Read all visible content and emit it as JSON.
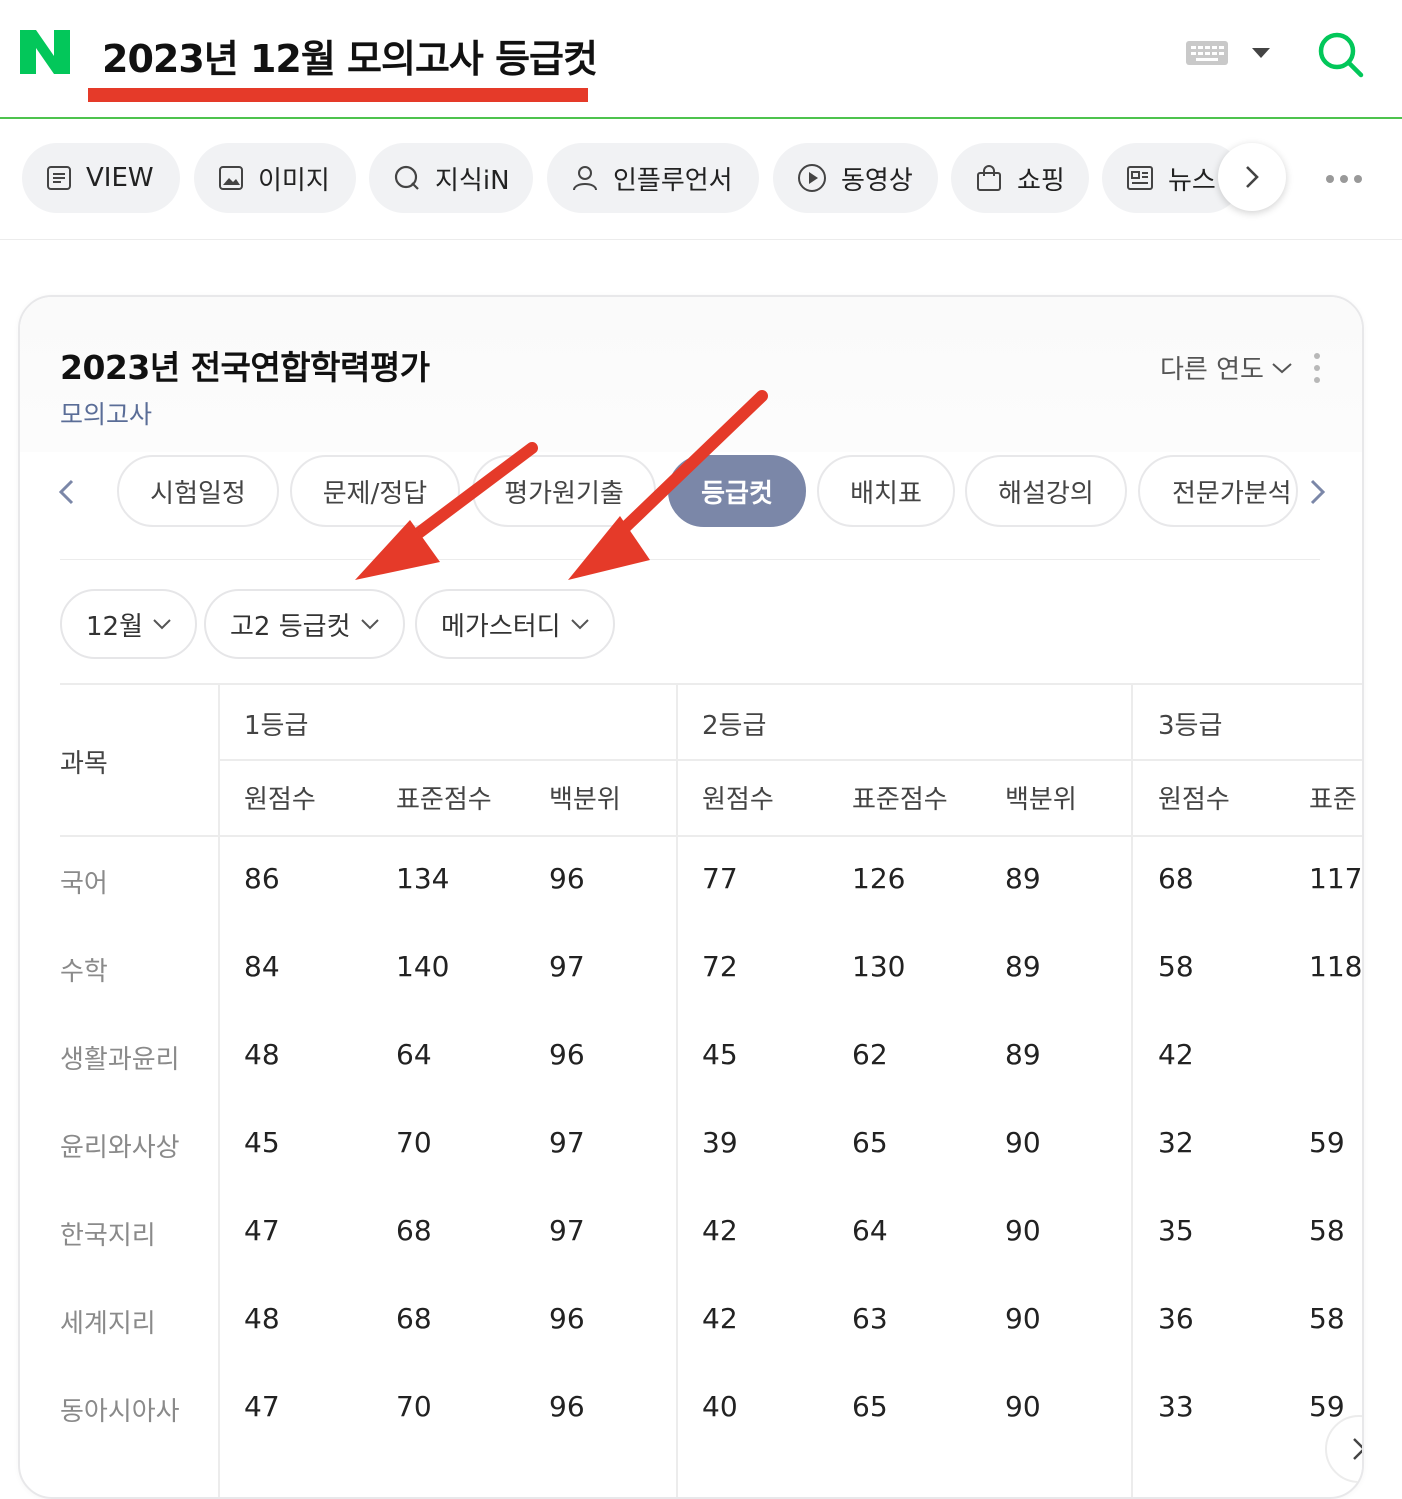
{
  "header": {
    "logo_letter": "N",
    "query": "2023년 12월 모의고사 등급컷",
    "brand_color": "#03c75a",
    "annotation_color": "#e53a29"
  },
  "tabs": [
    {
      "label": "VIEW",
      "icon": "document-list-icon"
    },
    {
      "label": "이미지",
      "icon": "image-icon"
    },
    {
      "label": "지식iN",
      "icon": "q-search-icon"
    },
    {
      "label": "인플루언서",
      "icon": "person-icon"
    },
    {
      "label": "동영상",
      "icon": "play-icon"
    },
    {
      "label": "쇼핑",
      "icon": "shopping-bag-icon"
    },
    {
      "label": "뉴스",
      "icon": "newspaper-icon"
    }
  ],
  "card": {
    "title": "2023년 전국연합학력평가",
    "subtitle": "모의고사",
    "year_select": "다른 연도",
    "sub_tabs": [
      "시험일정",
      "문제/정답",
      "평가원기출",
      "등급컷",
      "배치표",
      "해설강의",
      "전문가분석"
    ],
    "active_sub_tab": "등급컷",
    "active_color": "#7b87a8",
    "filters": [
      "12월",
      "고2 등급컷",
      "메가스터디"
    ]
  },
  "table": {
    "subject_header": "과목",
    "grades": [
      "1등급",
      "2등급",
      "3등급"
    ],
    "columns": [
      "원점수",
      "표준점수",
      "백분위",
      "원점수",
      "표준점수",
      "백분위",
      "원점수",
      "표준"
    ],
    "rows": [
      {
        "subject": "국어",
        "values": [
          "86",
          "134",
          "96",
          "77",
          "126",
          "89",
          "68",
          "117"
        ]
      },
      {
        "subject": "수학",
        "values": [
          "84",
          "140",
          "97",
          "72",
          "130",
          "89",
          "58",
          "118"
        ]
      },
      {
        "subject": "생활과윤리",
        "values": [
          "48",
          "64",
          "96",
          "45",
          "62",
          "89",
          "42",
          ""
        ]
      },
      {
        "subject": "윤리와사상",
        "values": [
          "45",
          "70",
          "97",
          "39",
          "65",
          "90",
          "32",
          "59"
        ]
      },
      {
        "subject": "한국지리",
        "values": [
          "47",
          "68",
          "97",
          "42",
          "64",
          "90",
          "35",
          "58"
        ]
      },
      {
        "subject": "세계지리",
        "values": [
          "48",
          "68",
          "96",
          "42",
          "63",
          "90",
          "36",
          "58"
        ]
      },
      {
        "subject": "동아시아사",
        "values": [
          "47",
          "70",
          "96",
          "40",
          "65",
          "90",
          "33",
          "59"
        ]
      }
    ]
  }
}
